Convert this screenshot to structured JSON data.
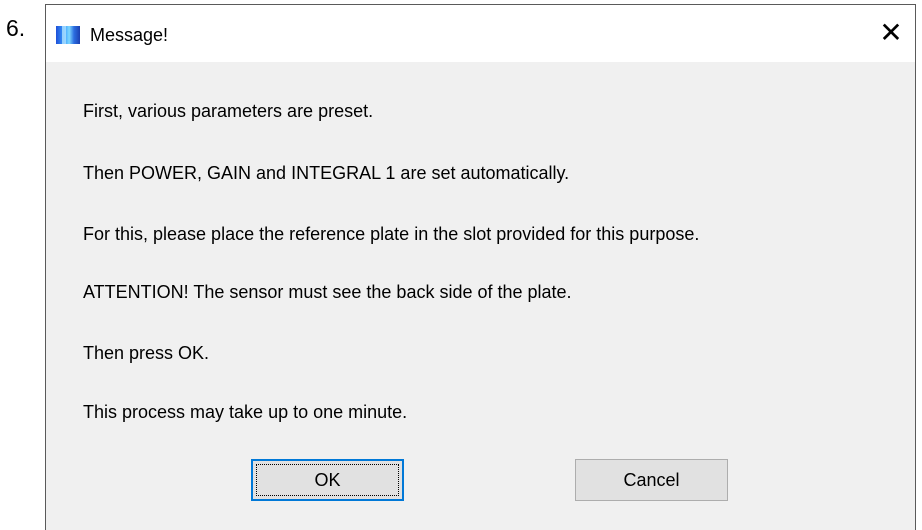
{
  "step_number": "6.",
  "window": {
    "title": "Message!",
    "close_glyph": "✕",
    "icon": "app-icon"
  },
  "message_lines": [
    "First, various parameters are preset.",
    "Then POWER, GAIN and INTEGRAL 1 are set automatically.",
    "For this, please place the reference plate in the slot provided for this purpose.",
    "ATTENTION! The sensor must see the back side of the plate.",
    "Then press OK.",
    "This process may take up to one minute."
  ],
  "buttons": {
    "ok_label": "OK",
    "cancel_label": "Cancel"
  },
  "colors": {
    "dialog_body": "#f0f0f0",
    "titlebar": "#ffffff",
    "focus_border": "#0078d7",
    "button_face": "#e1e1e1"
  }
}
